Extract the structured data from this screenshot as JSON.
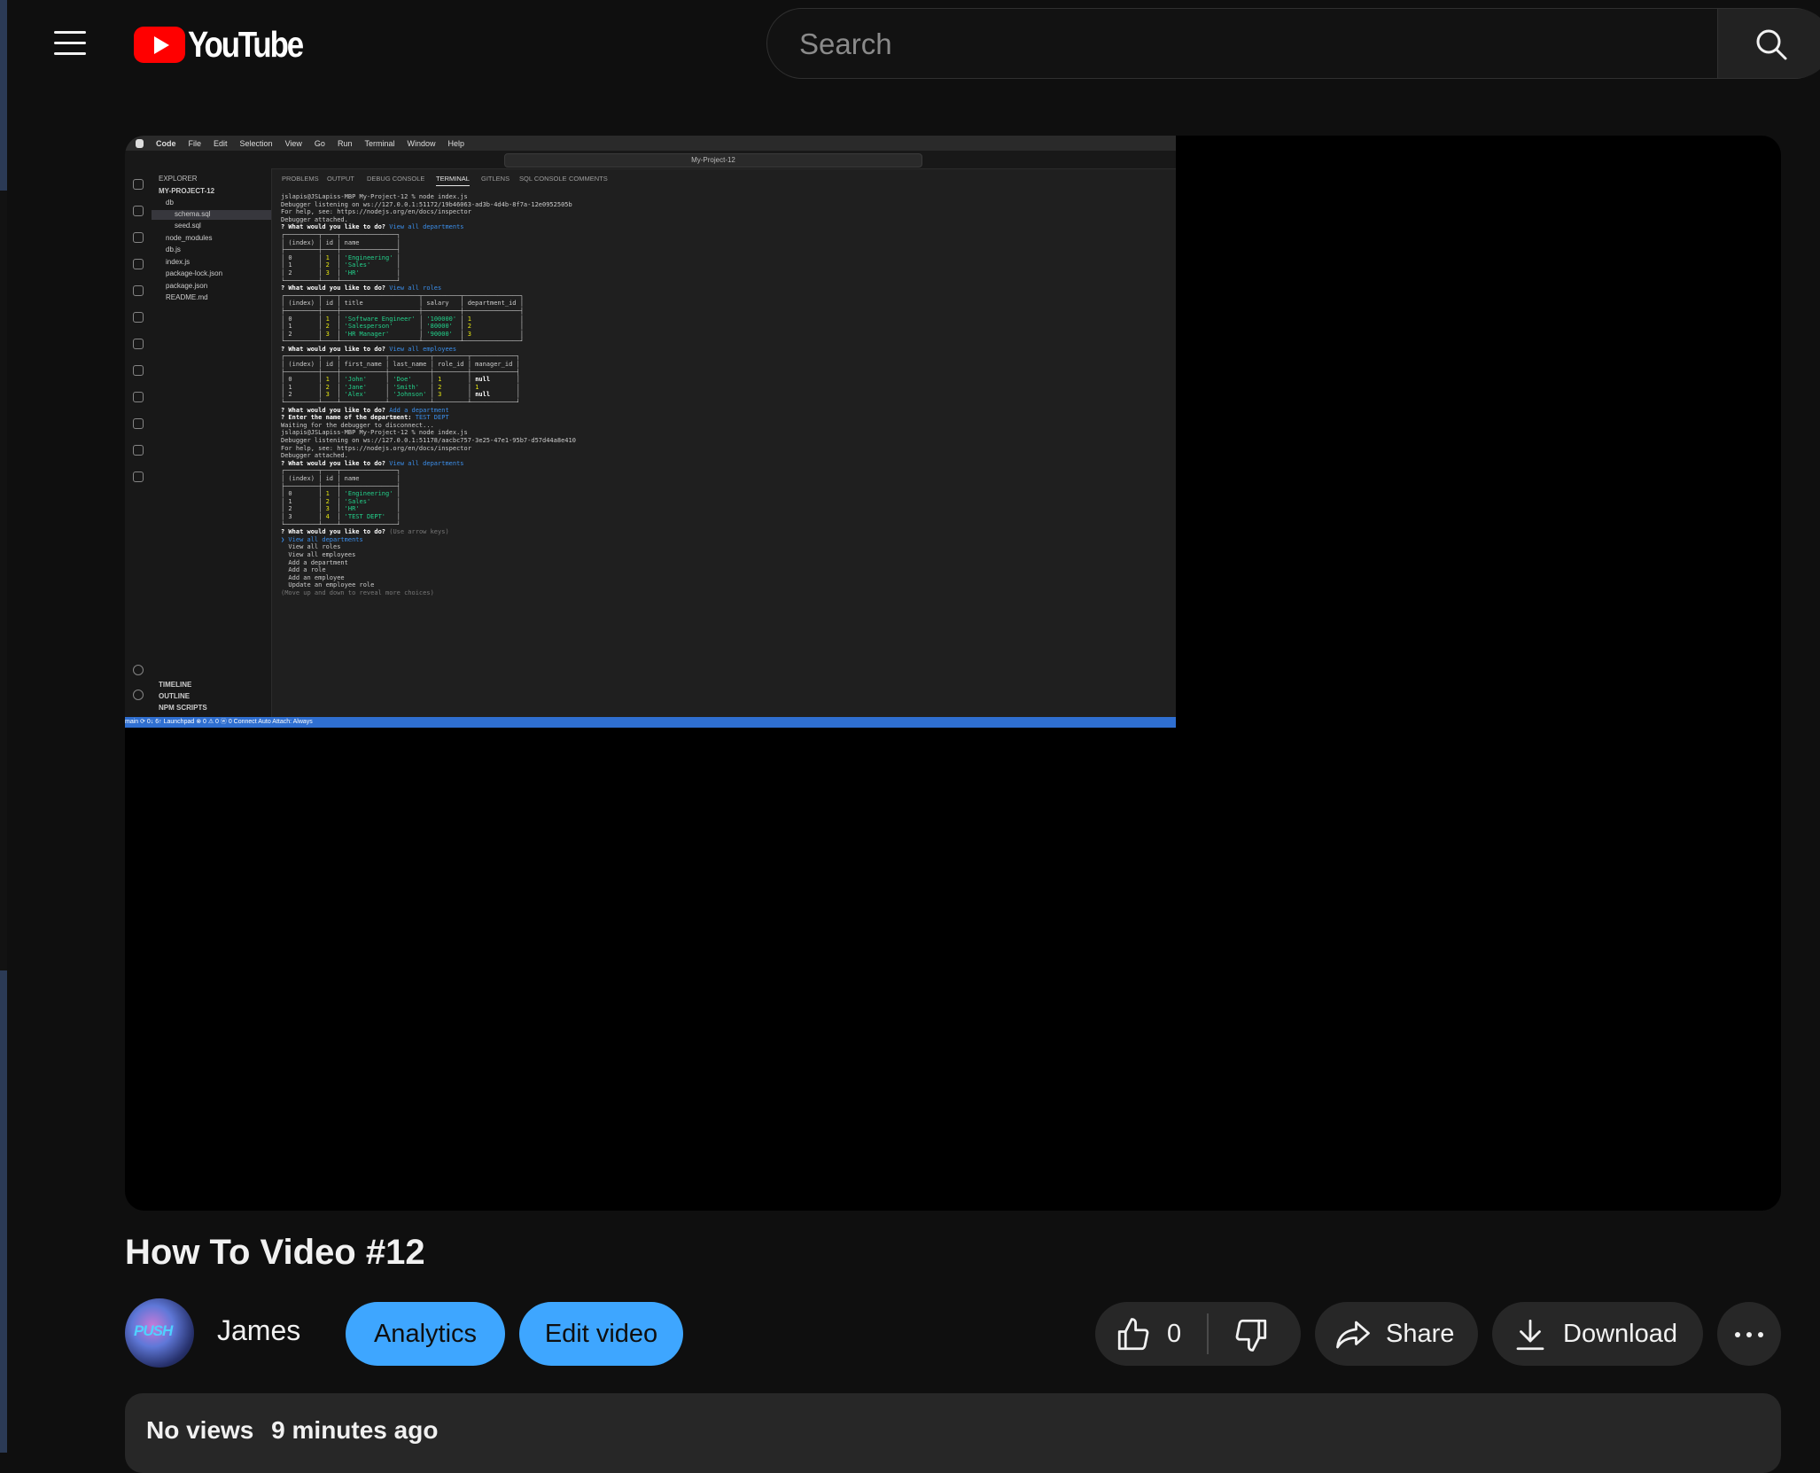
{
  "header": {
    "logo_text": "YouTube",
    "search_placeholder": "Search"
  },
  "player": {
    "ide_menu": [
      "Code",
      "File",
      "Edit",
      "Selection",
      "View",
      "Go",
      "Run",
      "Terminal",
      "Window",
      "Help"
    ],
    "ide_title": "My-Project-12",
    "explorer_header": "EXPLORER",
    "project_name": "MY-PROJECT-12",
    "files": [
      "db",
      "schema.sql",
      "seed.sql",
      "node_modules",
      "db.js",
      "index.js",
      "package-lock.json",
      "package.json",
      "README.md"
    ],
    "sections": [
      "TIMELINE",
      "OUTLINE",
      "NPM SCRIPTS"
    ],
    "panel_tabs": [
      "PROBLEMS",
      "OUTPUT",
      "DEBUG CONSOLE",
      "TERMINAL",
      "GITLENS",
      "SQL CONSOLE",
      "COMMENTS"
    ],
    "status_text": "main  ⟳ 0↓ 6↑   Launchpad   ⊗ 0 ⚠ 0   ⓦ 0   Connect   Auto Attach: Always"
  },
  "video": {
    "title": "How To Video #12",
    "channel_name": "James",
    "avatar_text": "PUSH"
  },
  "actions": {
    "analytics_label": "Analytics",
    "edit_label": "Edit video",
    "like_count": "0",
    "share_label": "Share",
    "download_label": "Download"
  },
  "description": {
    "views": "No views",
    "time_ago": "9 minutes ago"
  },
  "colors": {
    "accent_blue": "#3ea6ff",
    "brand_red": "#ff0000",
    "background": "#0f0f0f",
    "button_dark": "#272727"
  }
}
